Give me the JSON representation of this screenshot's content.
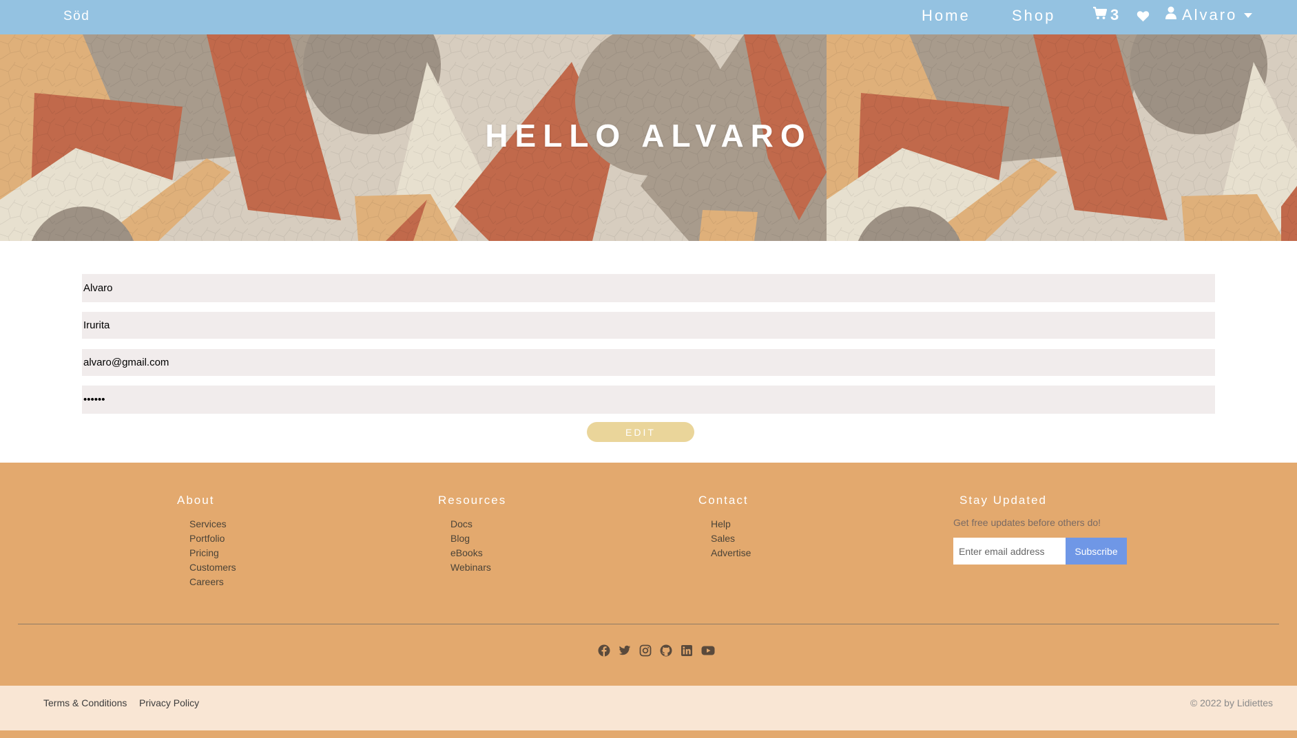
{
  "navbar": {
    "brand": "Söd",
    "home_label": "Home",
    "shop_label": "Shop",
    "cart_count": "3",
    "user_name": "Alvaro",
    "icons": {
      "cart": "cart-icon",
      "favorites": "heart-icon",
      "user": "user-icon",
      "dropdown": "chevron-down-icon"
    }
  },
  "hero": {
    "title": "HELLO ALVARO"
  },
  "profile_form": {
    "first_name": "Alvaro",
    "last_name": "Irurita",
    "email": "alvaro@gmail.com",
    "password": "••••••",
    "edit_label": "EDIT"
  },
  "footer": {
    "about": {
      "heading": "About",
      "links": [
        "Services",
        "Portfolio",
        "Pricing",
        "Customers",
        "Careers"
      ]
    },
    "resources": {
      "heading": "Resources",
      "links": [
        "Docs",
        "Blog",
        "eBooks",
        "Webinars"
      ]
    },
    "contact": {
      "heading": "Contact",
      "links": [
        "Help",
        "Sales",
        "Advertise"
      ]
    },
    "stay_updated": {
      "heading": "Stay Updated",
      "text": "Get free updates before others do!",
      "email_placeholder": "Enter email address",
      "subscribe_label": "Subscribe"
    },
    "social_icons": [
      "facebook-icon",
      "twitter-icon",
      "instagram-icon",
      "github-icon",
      "linkedin-icon",
      "youtube-icon"
    ]
  },
  "bottom_bar": {
    "terms_label": "Terms & Conditions",
    "privacy_label": "Privacy Policy",
    "copyright": "© 2022 by Lidiettes"
  },
  "colors": {
    "navbar": "#94c2e1",
    "footer": "#e3a96e",
    "bottom_bar": "#f9e6d4",
    "edit_button": "#ead59a",
    "subscribe_button": "#6f97e6",
    "input_background": "#f1ecec"
  }
}
